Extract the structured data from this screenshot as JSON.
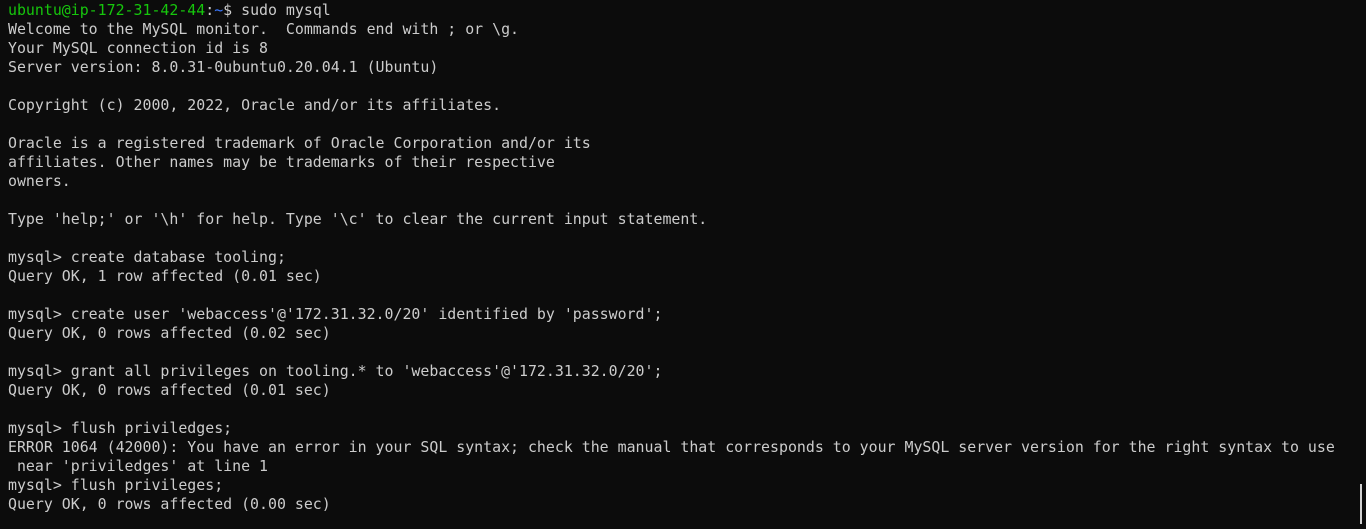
{
  "prompt": {
    "user_host": "ubuntu@ip-172-31-42-44",
    "sep": ":",
    "path": "~",
    "symbol": "$",
    "command": " sudo mysql"
  },
  "lines": [
    "Welcome to the MySQL monitor.  Commands end with ; or \\g.",
    "Your MySQL connection id is 8",
    "Server version: 8.0.31-0ubuntu0.20.04.1 (Ubuntu)",
    "",
    "Copyright (c) 2000, 2022, Oracle and/or its affiliates.",
    "",
    "Oracle is a registered trademark of Oracle Corporation and/or its",
    "affiliates. Other names may be trademarks of their respective",
    "owners.",
    "",
    "Type 'help;' or '\\h' for help. Type '\\c' to clear the current input statement.",
    "",
    "mysql> create database tooling;",
    "Query OK, 1 row affected (0.01 sec)",
    "",
    "mysql> create user 'webaccess'@'172.31.32.0/20' identified by 'password';",
    "Query OK, 0 rows affected (0.02 sec)",
    "",
    "mysql> grant all privileges on tooling.* to 'webaccess'@'172.31.32.0/20';",
    "Query OK, 0 rows affected (0.01 sec)",
    "",
    "mysql> flush priviledges;",
    "ERROR 1064 (42000): You have an error in your SQL syntax; check the manual that corresponds to your MySQL server version for the right syntax to use",
    " near 'priviledges' at line 1",
    "mysql> flush privileges;",
    "Query OK, 0 rows affected (0.00 sec)"
  ],
  "colors": {
    "background": "#0c0c0c",
    "text": "#cccccc",
    "prompt_user": "#16c60c",
    "prompt_path": "#3b78ff"
  }
}
